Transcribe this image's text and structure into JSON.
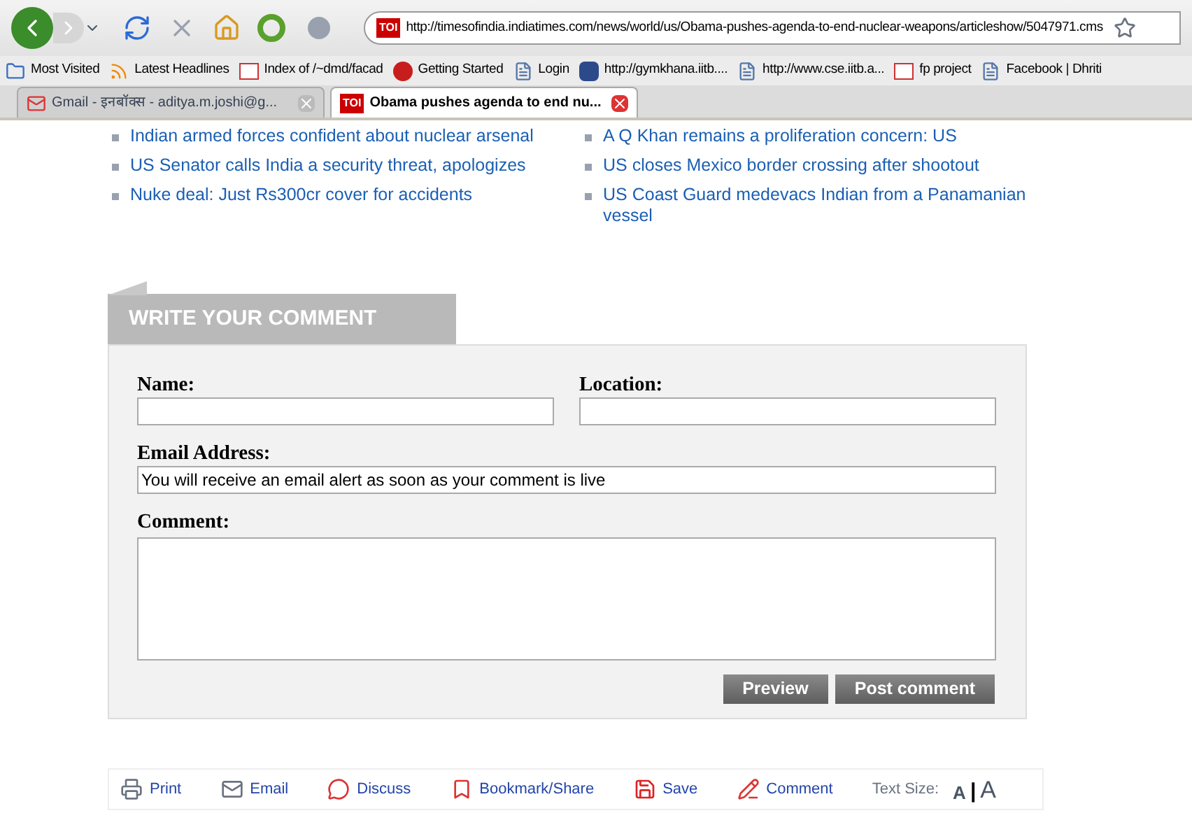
{
  "browser": {
    "url": "http://timesofindia.indiatimes.com/news/world/us/Obama-pushes-agenda-to-end-nuclear-weapons/articleshow/5047971.cms",
    "bookmarks": [
      {
        "label": "Most Visited",
        "kind": "folder"
      },
      {
        "label": "Latest Headlines",
        "kind": "feed"
      },
      {
        "label": "Index of /~dmd/facad",
        "kind": "site"
      },
      {
        "label": "Getting Started",
        "kind": "fox"
      },
      {
        "label": "Login",
        "kind": "page"
      },
      {
        "label": "http://gymkhana.iitb....",
        "kind": "iitb"
      },
      {
        "label": "http://www.cse.iitb.a...",
        "kind": "page"
      },
      {
        "label": "fp project",
        "kind": "site"
      },
      {
        "label": "Facebook | Dhriti",
        "kind": "page"
      }
    ],
    "tabs": [
      {
        "label": "Gmail - इनबॉक्स - aditya.m.joshi@g...",
        "kind": "mail",
        "selected": false
      },
      {
        "label": "Obama pushes agenda to end nu...",
        "kind": "toi",
        "favicon": "TOI",
        "selected": true
      }
    ],
    "favicon": "TOI"
  },
  "related_links": [
    [
      "Indian armed forces confident about nuclear arsenal",
      "US Senator calls India a security threat, apologizes",
      "Nuke deal: Just Rs300cr cover for accidents"
    ],
    [
      "A Q Khan remains a proliferation concern: US",
      "US closes Mexico border crossing after shootout",
      "US Coast Guard medevacs Indian from a Panamanian vessel"
    ]
  ],
  "comment_form": {
    "title": "WRITE YOUR COMMENT",
    "name_label": "Name:",
    "location_label": "Location:",
    "email_label": "Email Address:",
    "email_value": "You will receive an email alert as soon as your comment is live",
    "comment_label": "Comment:",
    "buttons": [
      "Preview",
      "Post comment"
    ]
  },
  "share_bar": {
    "items": [
      {
        "label": "Print",
        "kind": "print"
      },
      {
        "label": "Email",
        "kind": "email"
      },
      {
        "label": "Discuss",
        "kind": "discuss"
      },
      {
        "label": "Bookmark/Share",
        "kind": "bookmark"
      },
      {
        "label": "Save",
        "kind": "save"
      },
      {
        "label": "Comment",
        "kind": "comment"
      }
    ],
    "text_size_label": "Text Size:",
    "small_a": "A",
    "separator": "|",
    "large_a": "A"
  }
}
